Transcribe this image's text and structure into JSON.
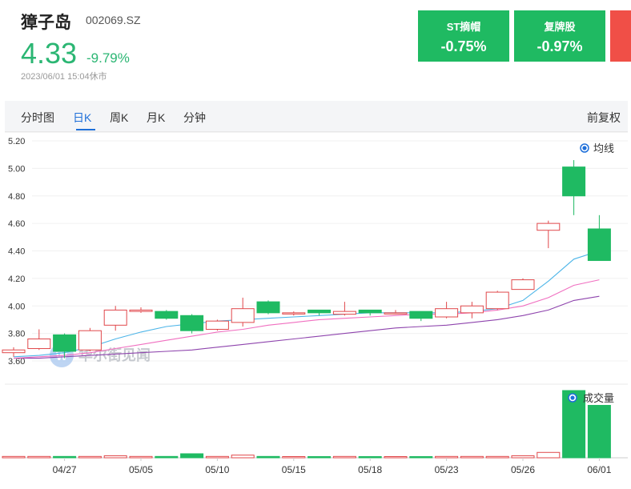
{
  "header": {
    "name": "獐子岛",
    "code": "002069.SZ",
    "price": "4.33",
    "change_pct": "-9.79%",
    "timestamp": "2023/06/01 15:04休市"
  },
  "cards": [
    {
      "name": "ST摘帽",
      "value": "-0.75%"
    },
    {
      "name": "复牌股",
      "value": "-0.97%"
    }
  ],
  "tabs": [
    "分时图",
    "日K",
    "周K",
    "月K",
    "分钟"
  ],
  "active_tab": "日K",
  "adjust_label": "前复权",
  "watermark": "华尔街见闻",
  "colors": {
    "up": "#e0484b",
    "down": "#1fba62",
    "ma5": "#4db5e8",
    "ma10": "#f06fc0",
    "ma20": "#8e44ad"
  },
  "chart_data": {
    "type": "candlestick",
    "y_ticks": [
      "5.20",
      "5.00",
      "4.80",
      "4.60",
      "4.40",
      "4.20",
      "4.00",
      "3.80",
      "3.60"
    ],
    "ylim": [
      3.6,
      5.2
    ],
    "x_tick_labels": [
      "04/27",
      "05/05",
      "05/10",
      "05/15",
      "05/18",
      "05/23",
      "05/26",
      "06/01"
    ],
    "x_tick_positions": [
      2,
      5,
      8,
      11,
      14,
      17,
      20,
      23
    ],
    "legend_ma": "均线",
    "legend_vol": "成交量",
    "candles": [
      {
        "o": 3.66,
        "c": 3.68,
        "h": 3.7,
        "l": 3.63
      },
      {
        "o": 3.69,
        "c": 3.76,
        "h": 3.83,
        "l": 3.68
      },
      {
        "o": 3.79,
        "c": 3.67,
        "h": 3.8,
        "l": 3.62
      },
      {
        "o": 3.68,
        "c": 3.82,
        "h": 3.84,
        "l": 3.67
      },
      {
        "o": 3.86,
        "c": 3.97,
        "h": 4.0,
        "l": 3.82
      },
      {
        "o": 3.96,
        "c": 3.97,
        "h": 3.99,
        "l": 3.95
      },
      {
        "o": 3.96,
        "c": 3.91,
        "h": 3.97,
        "l": 3.9
      },
      {
        "o": 3.93,
        "c": 3.82,
        "h": 3.94,
        "l": 3.8
      },
      {
        "o": 3.83,
        "c": 3.89,
        "h": 3.9,
        "l": 3.82
      },
      {
        "o": 3.88,
        "c": 3.98,
        "h": 4.06,
        "l": 3.85
      },
      {
        "o": 4.03,
        "c": 3.95,
        "h": 4.04,
        "l": 3.94
      },
      {
        "o": 3.95,
        "c": 3.95,
        "h": 3.96,
        "l": 3.93
      },
      {
        "o": 3.97,
        "c": 3.95,
        "h": 3.97,
        "l": 3.93
      },
      {
        "o": 3.94,
        "c": 3.96,
        "h": 4.03,
        "l": 3.93
      },
      {
        "o": 3.97,
        "c": 3.95,
        "h": 3.97,
        "l": 3.93
      },
      {
        "o": 3.95,
        "c": 3.95,
        "h": 3.97,
        "l": 3.94
      },
      {
        "o": 3.96,
        "c": 3.91,
        "h": 3.96,
        "l": 3.89
      },
      {
        "o": 3.92,
        "c": 3.98,
        "h": 4.03,
        "l": 3.91
      },
      {
        "o": 3.95,
        "c": 4.0,
        "h": 4.03,
        "l": 3.91
      },
      {
        "o": 3.98,
        "c": 4.1,
        "h": 4.11,
        "l": 3.97
      },
      {
        "o": 4.12,
        "c": 4.19,
        "h": 4.2,
        "l": 4.12
      },
      {
        "o": 4.55,
        "c": 4.6,
        "h": 4.62,
        "l": 4.42
      },
      {
        "o": 5.01,
        "c": 4.8,
        "h": 5.06,
        "l": 4.66
      },
      {
        "o": 4.56,
        "c": 4.33,
        "h": 4.66,
        "l": 4.33
      }
    ],
    "volume": [
      0.02,
      0.02,
      0.02,
      0.02,
      0.03,
      0.02,
      0.02,
      0.06,
      0.02,
      0.04,
      0.02,
      0.01,
      0.01,
      0.02,
      0.01,
      0.01,
      0.01,
      0.02,
      0.02,
      0.02,
      0.03,
      0.08,
      1.0,
      0.78
    ],
    "ma5": [
      3.63,
      3.64,
      3.66,
      3.7,
      3.76,
      3.81,
      3.85,
      3.87,
      3.89,
      3.9,
      3.91,
      3.92,
      3.93,
      3.94,
      3.95,
      3.95,
      3.95,
      3.95,
      3.96,
      3.98,
      4.04,
      4.18,
      4.34,
      4.4
    ],
    "ma10": [
      3.62,
      3.63,
      3.64,
      3.66,
      3.69,
      3.72,
      3.75,
      3.78,
      3.81,
      3.83,
      3.86,
      3.88,
      3.9,
      3.91,
      3.92,
      3.93,
      3.94,
      3.94,
      3.95,
      3.97,
      4.0,
      4.06,
      4.15,
      4.19
    ],
    "ma20": [
      3.62,
      3.62,
      3.63,
      3.64,
      3.65,
      3.66,
      3.67,
      3.68,
      3.7,
      3.72,
      3.74,
      3.76,
      3.78,
      3.8,
      3.82,
      3.84,
      3.85,
      3.86,
      3.88,
      3.9,
      3.93,
      3.97,
      4.04,
      4.07
    ]
  }
}
